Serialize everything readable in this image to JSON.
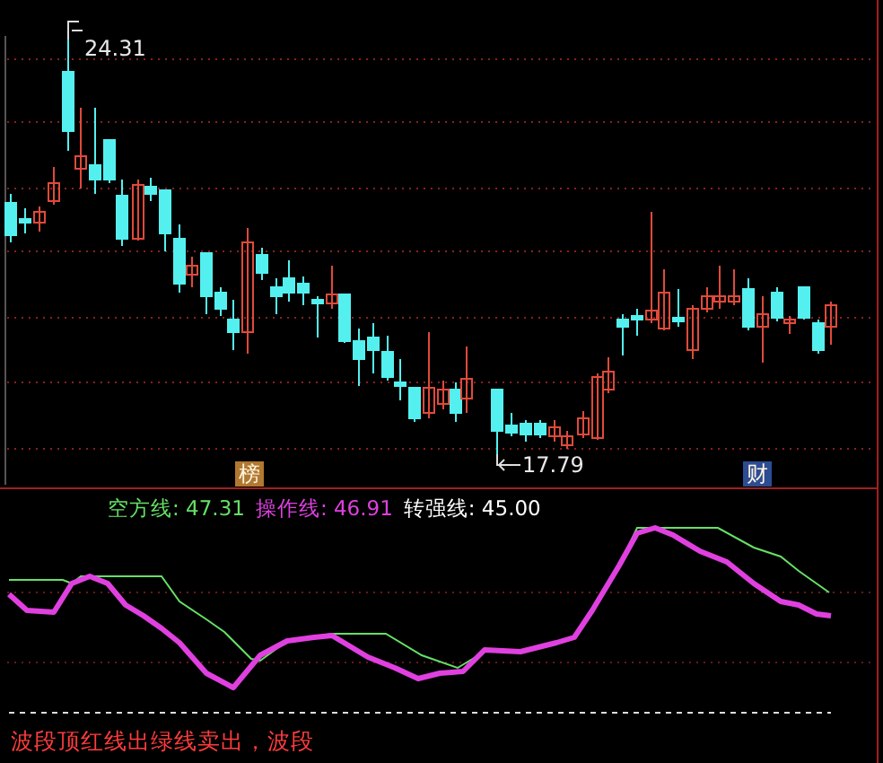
{
  "price_chart": {
    "high_label": "24.31",
    "low_label": "17.79",
    "markers": [
      {
        "label": "榜",
        "color": "#b07830"
      },
      {
        "label": "财",
        "color": "#2c4c94"
      }
    ]
  },
  "indicator": {
    "legend": [
      {
        "label": "空方线: 47.31",
        "color": "#66e066"
      },
      {
        "label": "操作线: 46.91",
        "color": "#e040e0"
      },
      {
        "label": "转强线: 45.00",
        "color": "#ffffff"
      }
    ]
  },
  "footer": {
    "text": "波段顶红线出绿线卖出，波段"
  }
}
